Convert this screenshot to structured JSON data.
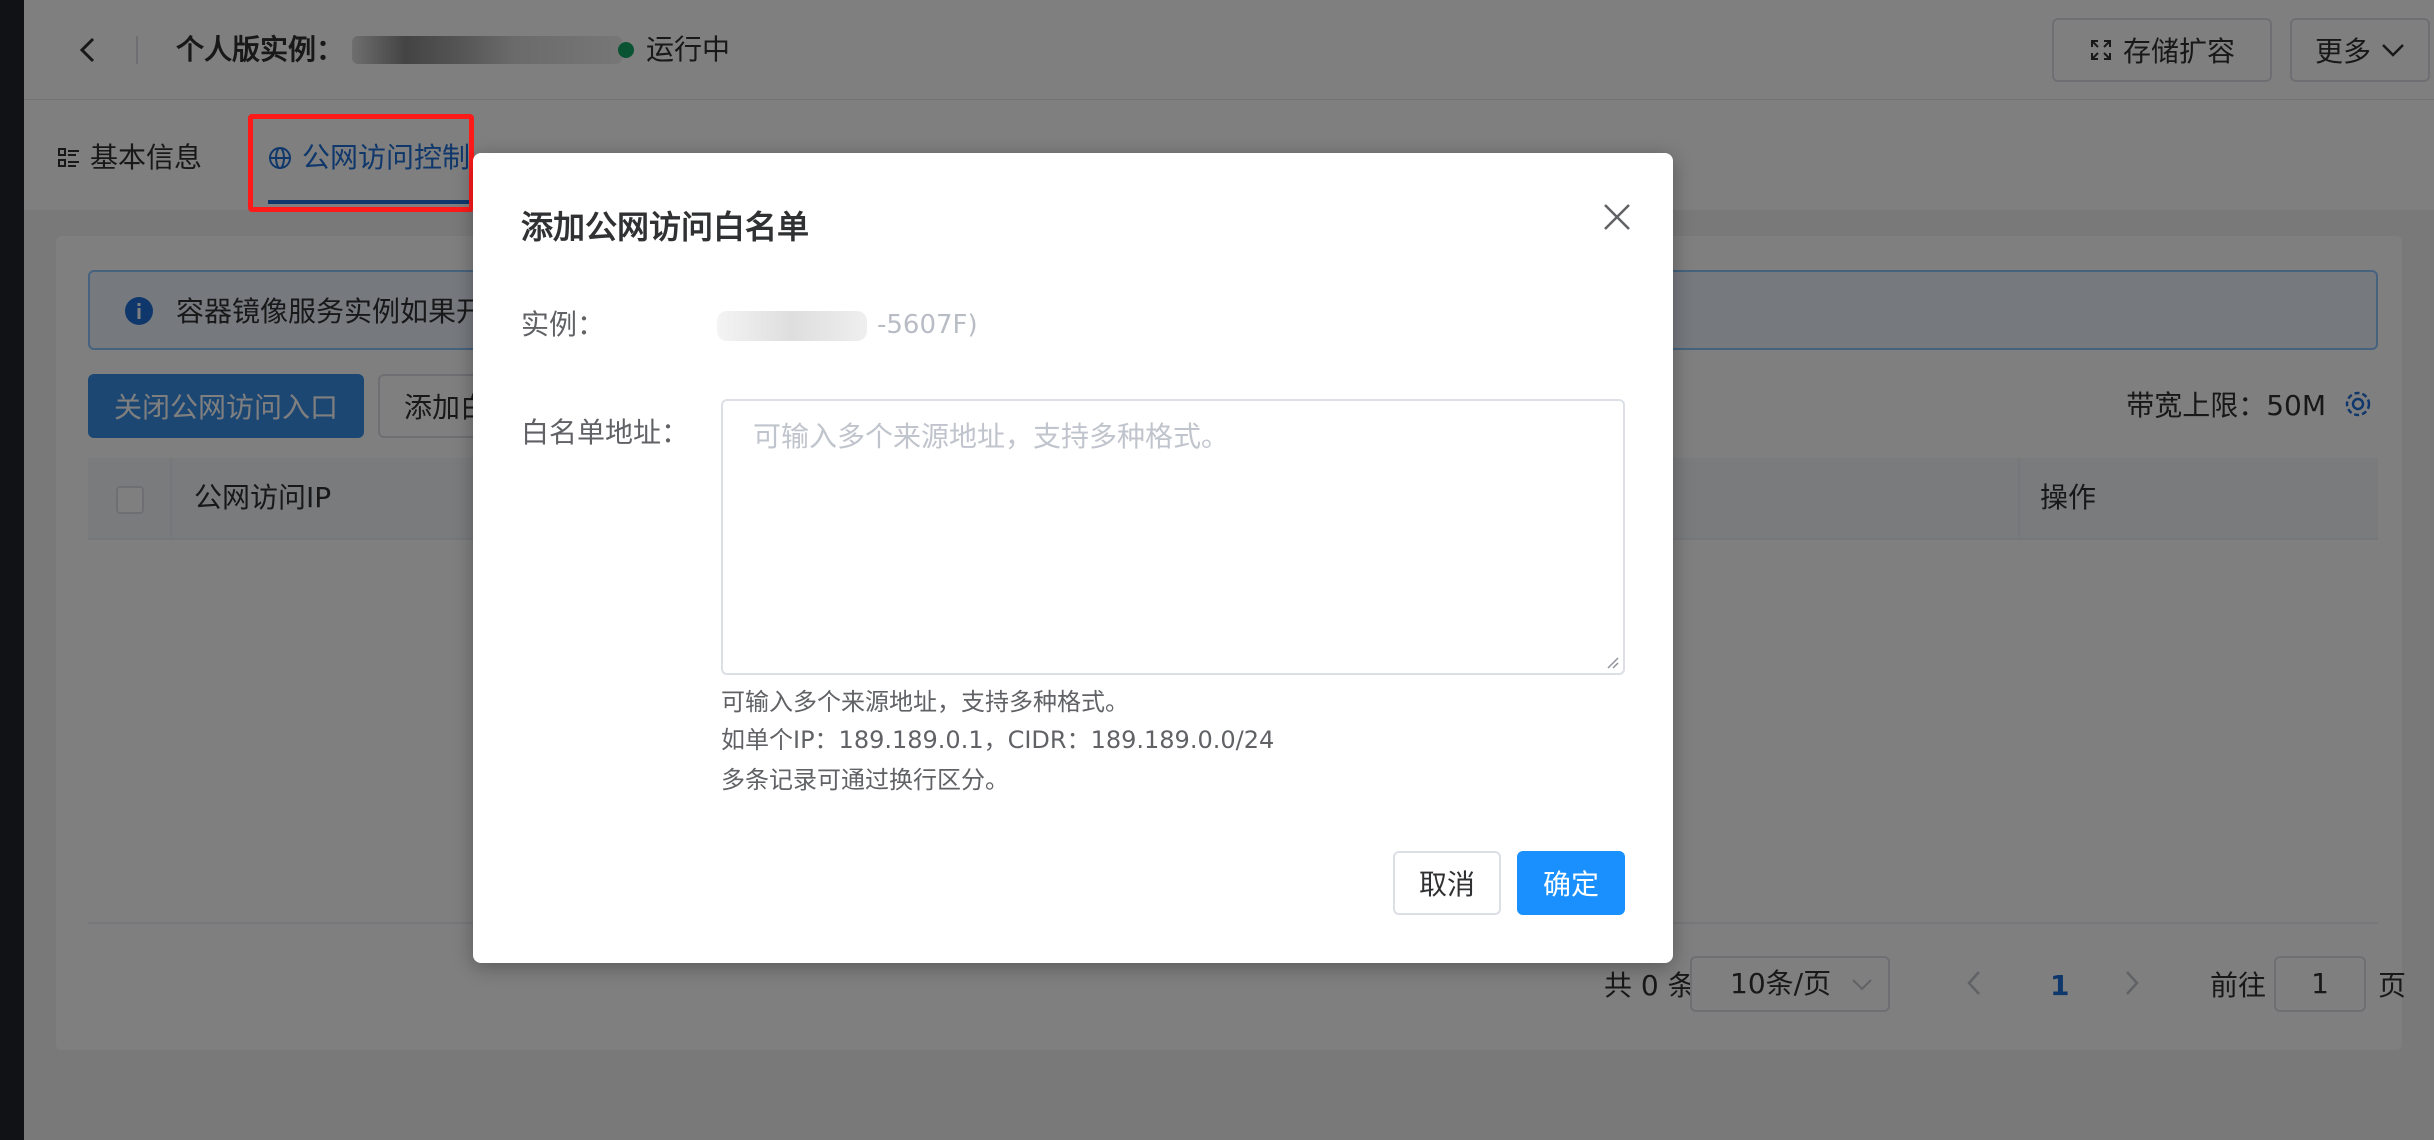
{
  "header": {
    "title": "个人版实例：",
    "status": "运行中",
    "status_color": "#13a764",
    "storage_expand_label": "存储扩容",
    "more_label": "更多"
  },
  "tabs": [
    {
      "label": "基本信息",
      "icon": "list-icon"
    },
    {
      "label": "公网访问控制",
      "icon": "globe-icon",
      "active": true
    }
  ],
  "alert": {
    "text": "容器镜像服务实例如果开"
  },
  "toolbar": {
    "close_public_access_label": "关闭公网访问入口",
    "add_label": "添加白",
    "bandwidth_label": "带宽上限：50M"
  },
  "table": {
    "columns": [
      "公网访问IP",
      "操作"
    ]
  },
  "pagination": {
    "total": "共 0 条",
    "page_size": "10条/页",
    "current_page": "1",
    "goto_label": "前往",
    "goto_value": "1",
    "page_suffix": "页"
  },
  "dialog": {
    "title": "添加公网访问白名单",
    "instance_label": "实例：",
    "instance_value": "-5607F)",
    "whitelist_label": "白名单地址：",
    "whitelist_placeholder": "可输入多个来源地址，支持多种格式。",
    "hints": [
      "可输入多个来源地址，支持多种格式。",
      "如单个IP：189.189.0.1，CIDR：189.189.0.0/24",
      "多条记录可通过换行区分。"
    ],
    "cancel_label": "取消",
    "confirm_label": "确定"
  },
  "colors": {
    "primary": "#1a90ff",
    "highlight": "#ff1a1a"
  }
}
